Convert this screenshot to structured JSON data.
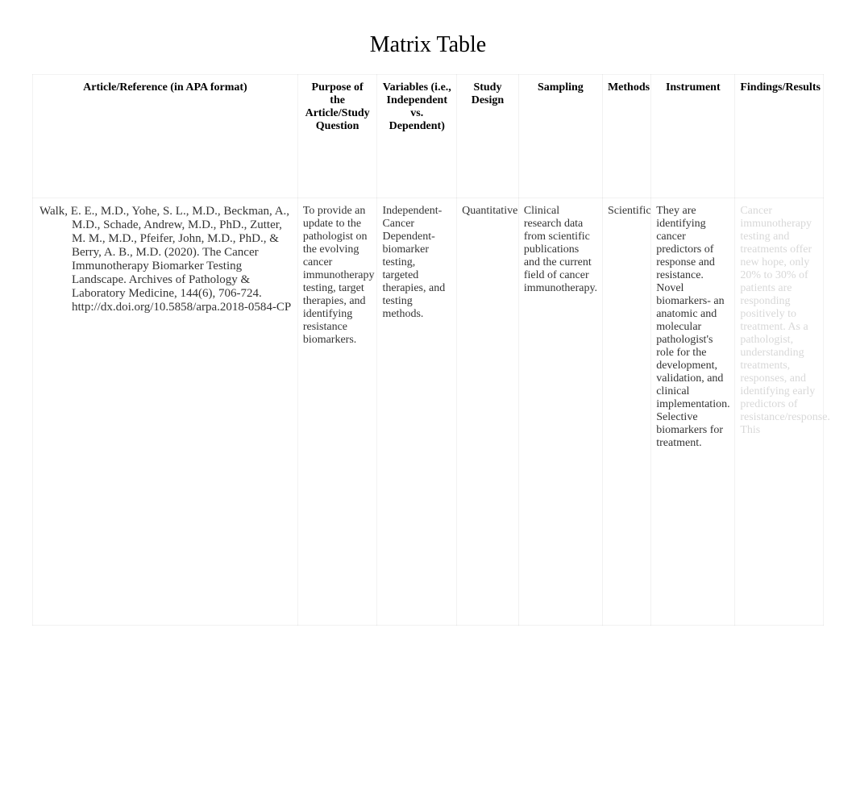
{
  "title": "Matrix Table",
  "headers": {
    "article": "Article/Reference (in APA format)",
    "purpose": "Purpose of the Article/Study Question",
    "variables": "Variables (i.e., Independent vs. Dependent)",
    "design": "Study Design",
    "sampling": "Sampling",
    "methods": "Methods",
    "instrument": "Instrument",
    "findings": "Findings/Results"
  },
  "rows": [
    {
      "article": "Walk, E. E., M.D., Yohe, S. L., M.D., Beckman, A., M.D., Schade, Andrew, M.D., PhD., Zutter, M. M., M.D., Pfeifer, John, M.D., PhD., & Berry, A. B., M.D. (2020). The Cancer Immunotherapy Biomarker Testing Landscape. Archives of Pathology & Laboratory Medicine, 144(6), 706-724. http://dx.doi.org/10.5858/arpa.2018-0584-CP",
      "purpose": "To provide an update to the pathologist on the evolving cancer immunotherapy testing, target therapies, and identifying resistance biomarkers.",
      "variables": "Independent- Cancer Dependent- biomarker testing, targeted therapies, and testing methods.",
      "design": "Quantitative",
      "sampling": "Clinical research data from scientific publications and the current field of cancer immunotherapy.",
      "methods": "Scientific",
      "instrument": "They are identifying cancer predictors of response and resistance. Novel biomarkers- an anatomic and molecular pathologist's role for the development, validation, and clinical implementation. Selective biomarkers for treatment.",
      "findings": "Cancer immunotherapy testing and treatments offer new hope, only 20% to 30% of patients are responding positively to treatment. As a pathologist, understanding treatments, responses, and identifying early predictors of resistance/response. This"
    }
  ]
}
